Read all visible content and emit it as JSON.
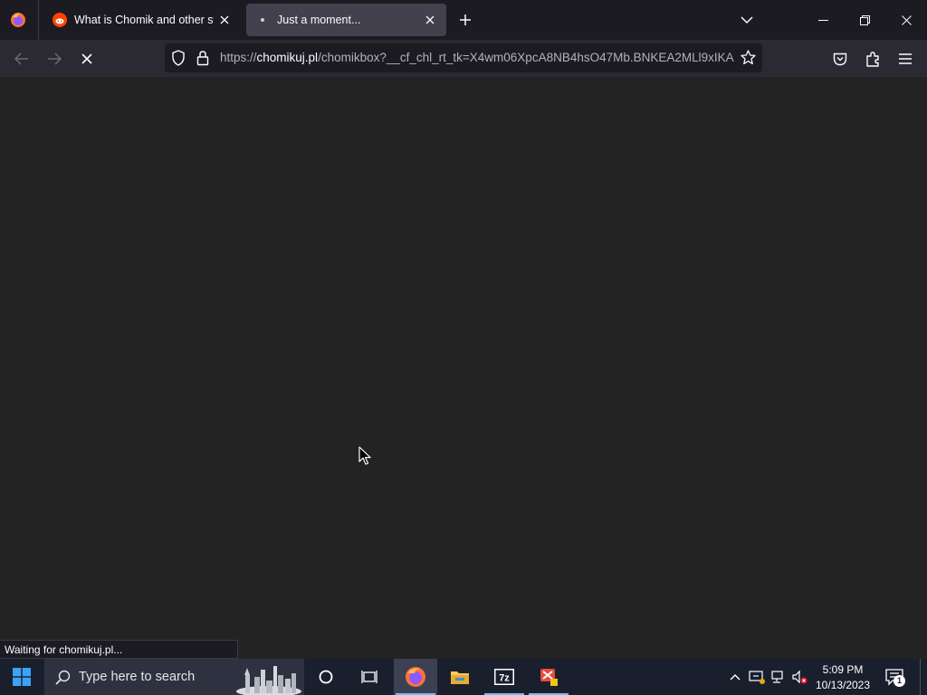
{
  "browser": {
    "tabs": [
      {
        "title": "What is Chomik and other stuff",
        "favicon": "reddit-icon",
        "active": false
      },
      {
        "title": "Just a moment...",
        "favicon": "loading-dot-icon",
        "active": true
      }
    ],
    "url": {
      "scheme": "https://",
      "host": "chomikuj.pl",
      "path": "/chomikbox?__cf_chl_rt_tk=X4wm06XpcA8NB4hsO47Mb.BNKEA2MLl9xIKA"
    },
    "status_text": "Waiting for chomikuj.pl..."
  },
  "taskbar": {
    "search_placeholder": "Type here to search",
    "apps": [
      "firefox-icon",
      "file-explorer-icon",
      "7zip-icon",
      "app-icon"
    ],
    "time": "5:09 PM",
    "date": "10/13/2023",
    "notification_count": "1",
    "accent_color": "#76b9ed"
  }
}
